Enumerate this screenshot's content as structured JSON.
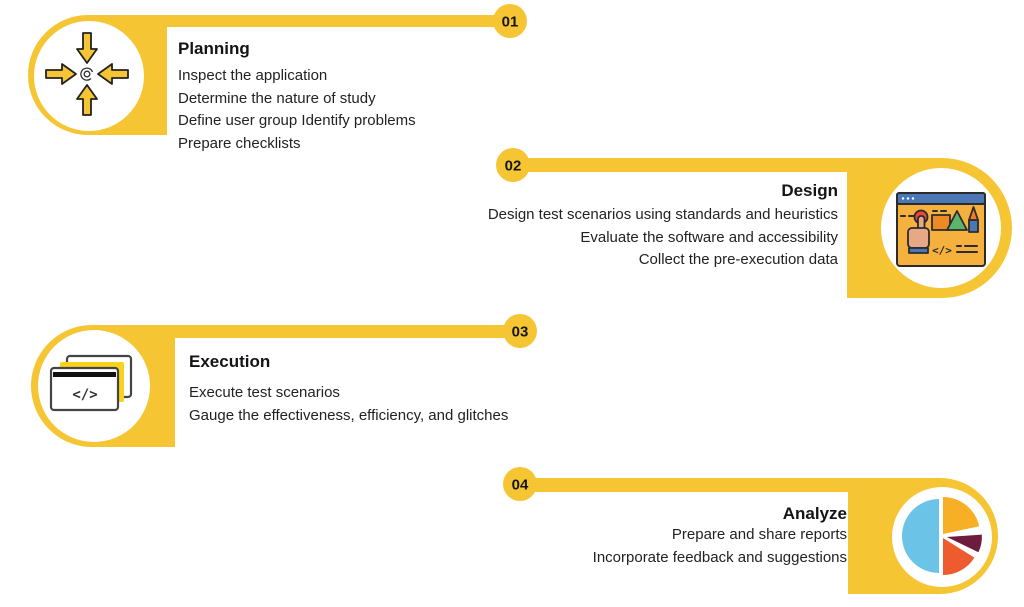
{
  "accent_color": "#F6C533",
  "steps": [
    {
      "number": "01",
      "title": "Planning",
      "icon": "converge-arrows-icon",
      "lines": [
        "Inspect the application",
        "Determine the nature of study",
        "Define user group Identify problems",
        "Prepare checklists"
      ]
    },
    {
      "number": "02",
      "title": "Design",
      "icon": "ui-design-window-icon",
      "lines": [
        "Design test scenarios using standards and heuristics",
        "Evaluate the software and accessibility",
        "Collect the pre-execution data"
      ]
    },
    {
      "number": "03",
      "title": "Execution",
      "icon": "code-windows-icon",
      "lines": [
        "Execute test scenarios",
        "Gauge the effectiveness, efficiency, and glitches"
      ]
    },
    {
      "number": "04",
      "title": "Analyze",
      "icon": "pie-chart-icon",
      "lines": [
        "Prepare and share reports",
        "Incorporate feedback and suggestions"
      ]
    }
  ],
  "icon_glyphs": {
    "code": "</>"
  },
  "colors": {
    "yellow": "#F6C533",
    "window_blue": "#4B77B7",
    "window_orange": "#F5B03E",
    "pie_blue": "#6BC4E8",
    "pie_yellow": "#F7AF26",
    "pie_maroon": "#6D1C3E",
    "pie_red": "#EE5B2E"
  }
}
